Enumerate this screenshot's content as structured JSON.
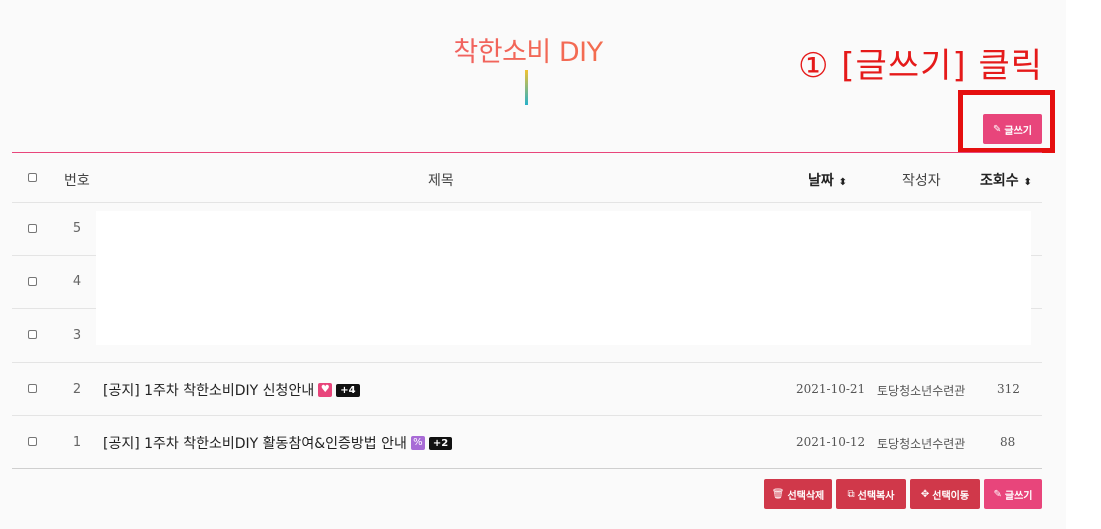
{
  "board": {
    "title": "착한소비 DIY"
  },
  "annotation": {
    "text": "① [글쓰기] 클릭"
  },
  "top_actions": {
    "write_label": "글쓰기"
  },
  "table": {
    "headers": {
      "number": "번호",
      "subject": "제목",
      "date": "날짜",
      "author": "작성자",
      "views": "조회수"
    },
    "rows": [
      {
        "number": "5",
        "subject": "",
        "date": "",
        "author": "",
        "views": ""
      },
      {
        "number": "4",
        "subject": "",
        "date": "",
        "author": "",
        "views": ""
      },
      {
        "number": "3",
        "subject": "",
        "date": "",
        "author": "",
        "views": ""
      },
      {
        "number": "2",
        "subject": "[공지] 1주차 착한소비DIY 신청안내",
        "badge": "+4",
        "date": "2021-10-21",
        "author": "토당청소년수련관",
        "views": "312"
      },
      {
        "number": "1",
        "subject": "[공지] 1주차 착한소비DIY 활동참여&인증방법 안내",
        "badge": "+2",
        "date": "2021-10-12",
        "author": "토당청소년수련관",
        "views": "88"
      }
    ]
  },
  "bottom_actions": {
    "delete_label": "선택삭제",
    "copy_label": "선택복사",
    "move_label": "선택이동",
    "write_label": "글쓰기"
  },
  "colors": {
    "accent": "#e8457b",
    "danger": "#d0384a",
    "annotation": "#e51a1a"
  }
}
